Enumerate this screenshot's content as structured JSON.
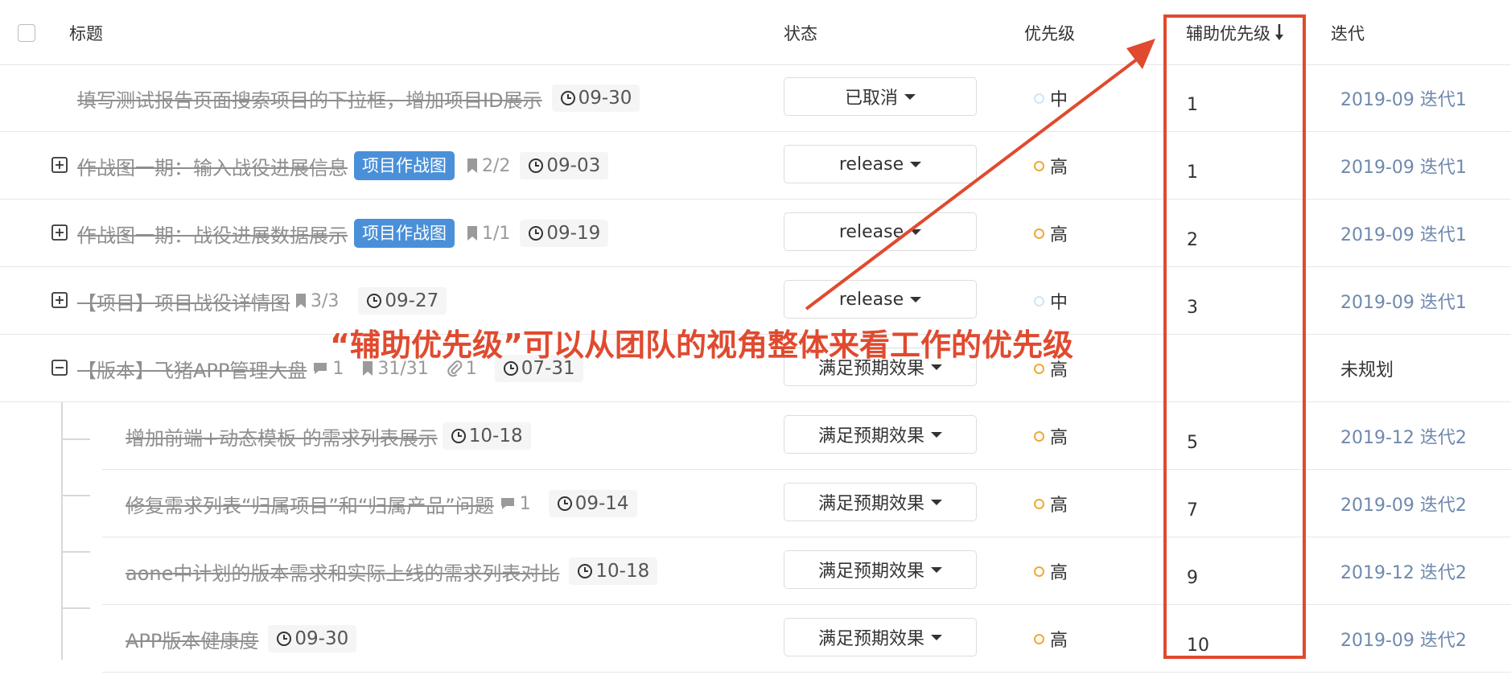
{
  "header": {
    "title_col": "标题",
    "status_col": "状态",
    "priority_col": "优先级",
    "aux_priority_col": "辅助优先级",
    "aux_sort_icon": "sort-descending-icon",
    "iteration_col": "迭代"
  },
  "rows": [
    {
      "title": "填写测试报告页面搜索项目的下拉框，增加项目ID展示",
      "due": "09-30",
      "status": "已取消",
      "priority": "中",
      "aux": "1",
      "iteration": "2019-09 迭代1"
    },
    {
      "title": "作战图一期：输入战役进展信息",
      "tag": "项目作战图",
      "subtasks": "2/2",
      "due": "09-03",
      "status": "release",
      "priority": "高",
      "aux": "1",
      "iteration": "2019-09 迭代1"
    },
    {
      "title": "作战图一期：战役进展数据展示",
      "tag": "项目作战图",
      "subtasks": "1/1",
      "due": "09-19",
      "status": "release",
      "priority": "高",
      "aux": "2",
      "iteration": "2019-09 迭代1"
    },
    {
      "title": "【项目】项目战役详情图",
      "subtasks": "3/3",
      "due": "09-27",
      "status": "release",
      "priority": "中",
      "aux": "3",
      "iteration": "2019-09 迭代1"
    },
    {
      "title": "【版本】飞猪APP管理大盘",
      "comments": "1",
      "subtasks": "31/31",
      "attachments": "1",
      "due": "07-31",
      "status": "满足预期效果",
      "priority": "高",
      "aux": "",
      "iteration": "未规划"
    },
    {
      "title": "增加前端+动态模板 的需求列表展示",
      "due": "10-18",
      "status": "满足预期效果",
      "priority": "高",
      "aux": "5",
      "iteration": "2019-12 迭代2"
    },
    {
      "title": "修复需求列表“归属项目”和“归属产品”问题",
      "comments": "1",
      "due": "09-14",
      "status": "满足预期效果",
      "priority": "高",
      "aux": "7",
      "iteration": "2019-09 迭代2"
    },
    {
      "title": "aone中计划的版本需求和实际上线的需求列表对比",
      "due": "10-18",
      "status": "满足预期效果",
      "priority": "高",
      "aux": "9",
      "iteration": "2019-12 迭代2"
    },
    {
      "title": "APP版本健康度",
      "due": "09-30",
      "status": "满足预期效果",
      "priority": "高",
      "aux": "10",
      "iteration": "2019-09 迭代2"
    }
  ],
  "annotation": "“辅助优先级”可以从团队的视角整体来看工作的优先级",
  "colors": {
    "accent": "#e04a2f",
    "tag": "#4a90d9",
    "iteration": "#6f89ad",
    "priority_high": "#f0a838"
  }
}
